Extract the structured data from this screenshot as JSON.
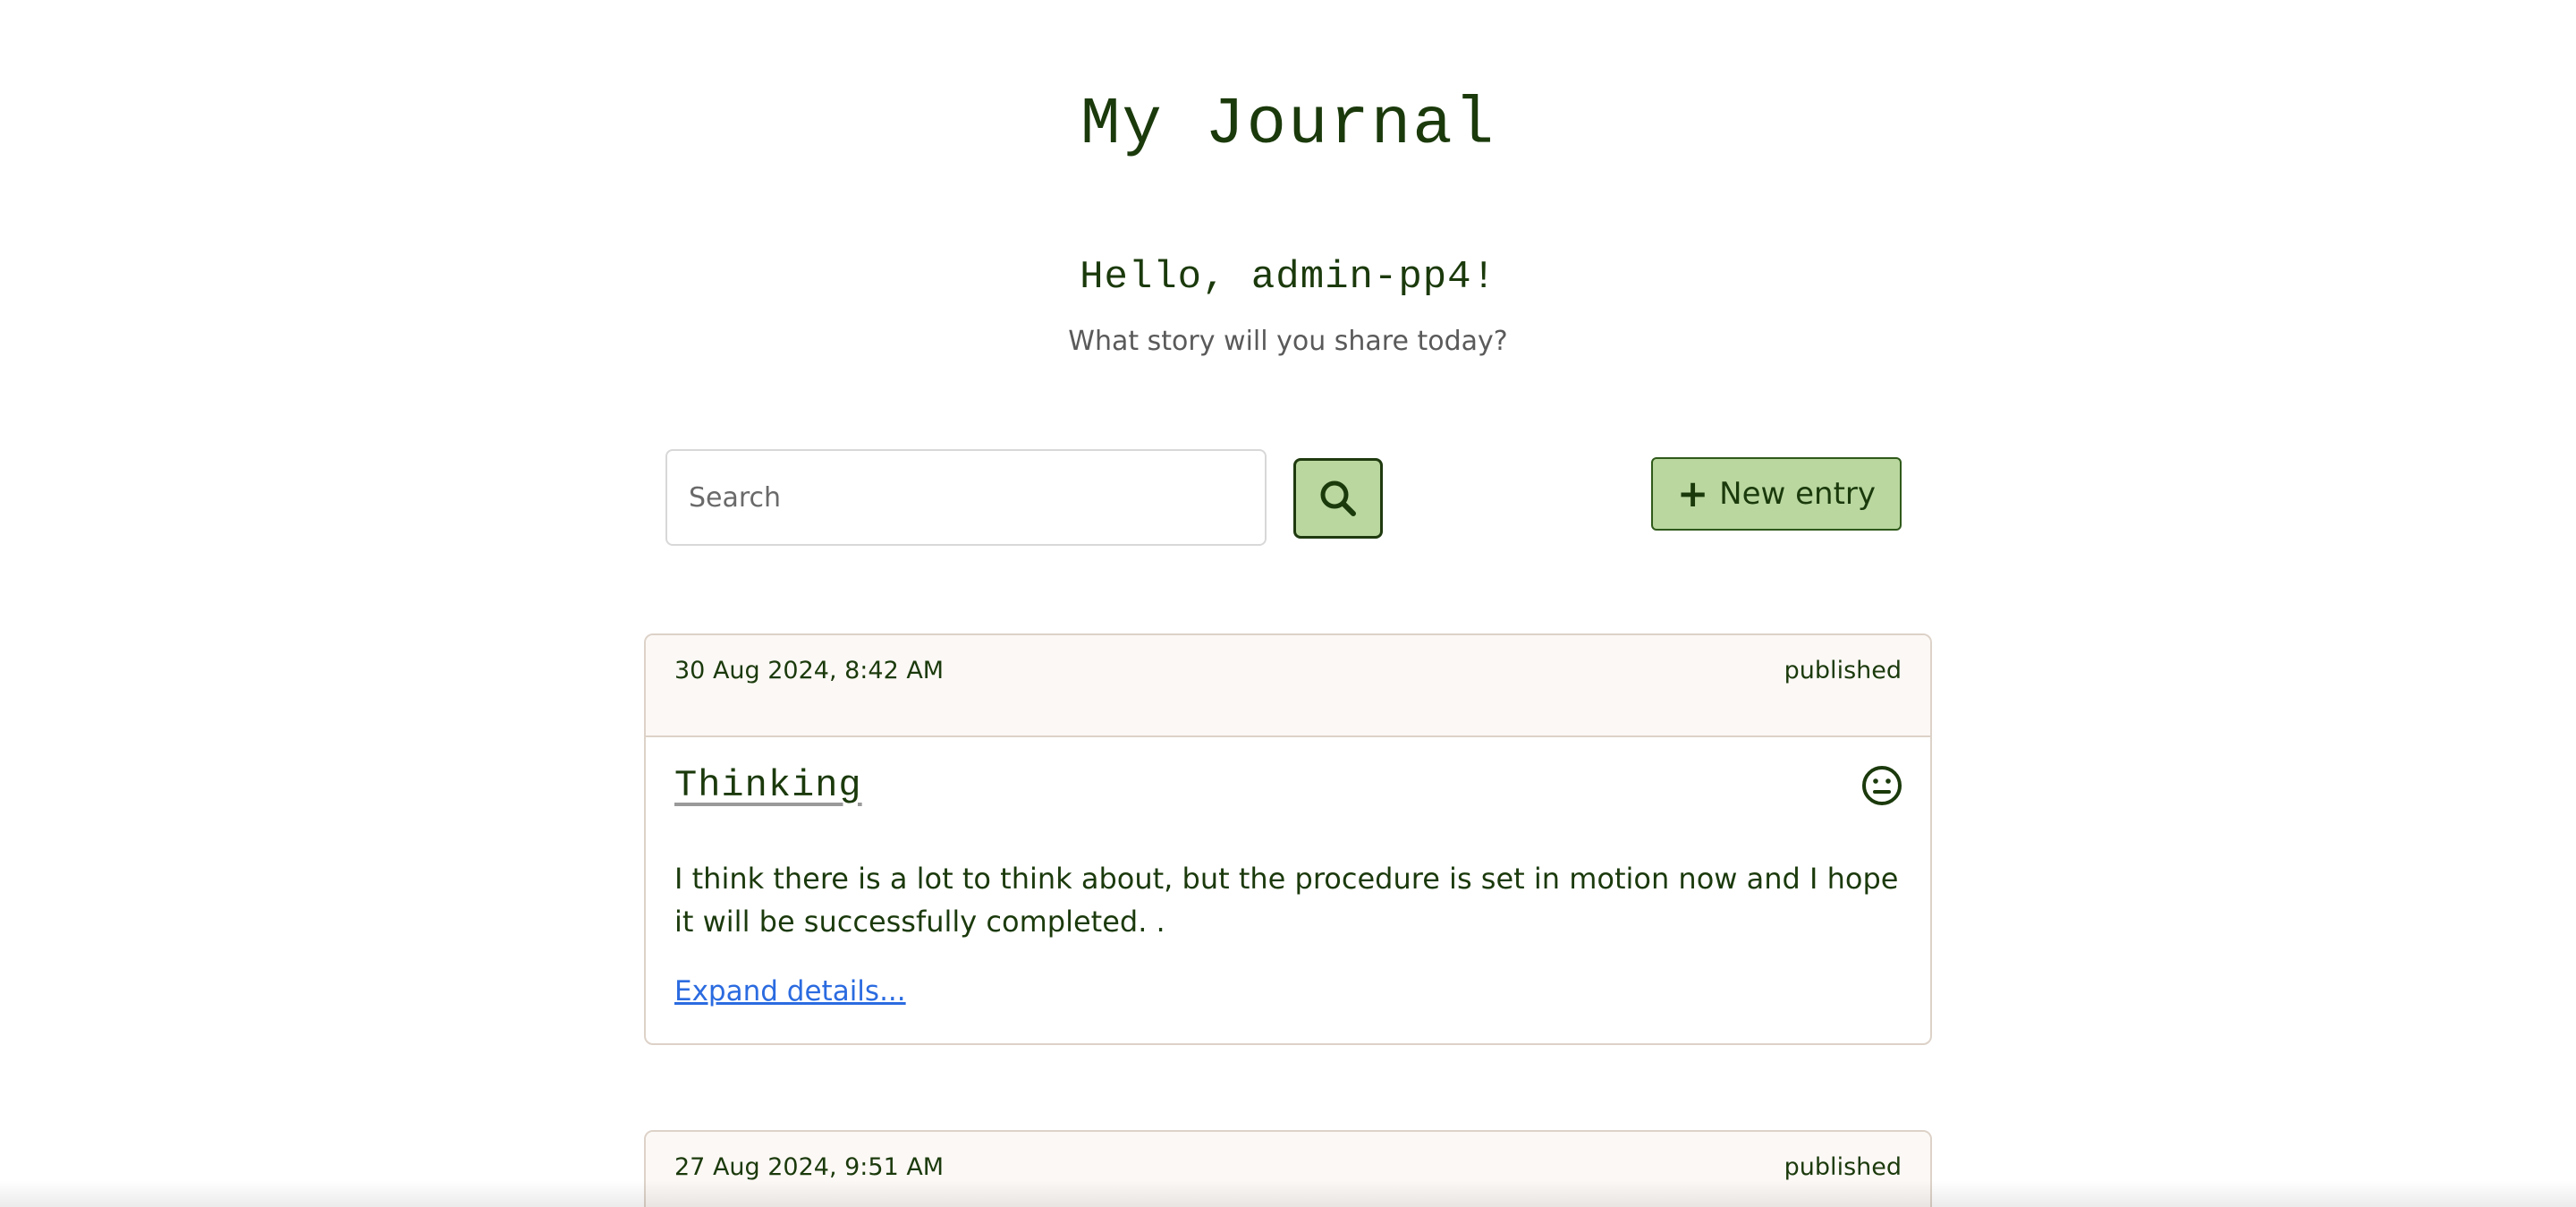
{
  "header": {
    "title": "My Journal",
    "greeting": "Hello, admin-pp4!",
    "subtitle": "What story will you share today?"
  },
  "search": {
    "placeholder": "Search",
    "value": "",
    "button_icon": "search-icon"
  },
  "actions": {
    "new_entry_label": "New entry",
    "new_entry_icon": "plus-icon"
  },
  "entries": [
    {
      "date": "30 Aug 2024, 8:42 AM",
      "status": "published",
      "title": "Thinking",
      "mood_icon": "neutral-face-icon",
      "excerpt": "I think there is a lot to think about, but the procedure is set in motion now and I hope it will be successfully completed. .",
      "expand_label": "Expand details..."
    },
    {
      "date": "27 Aug 2024, 9:51 AM",
      "status": "published"
    }
  ],
  "colors": {
    "primary_text": "#1b3a0c",
    "button_bg": "#b9d79f",
    "card_header_bg": "#fcf8f5",
    "link": "#2b6be0"
  }
}
